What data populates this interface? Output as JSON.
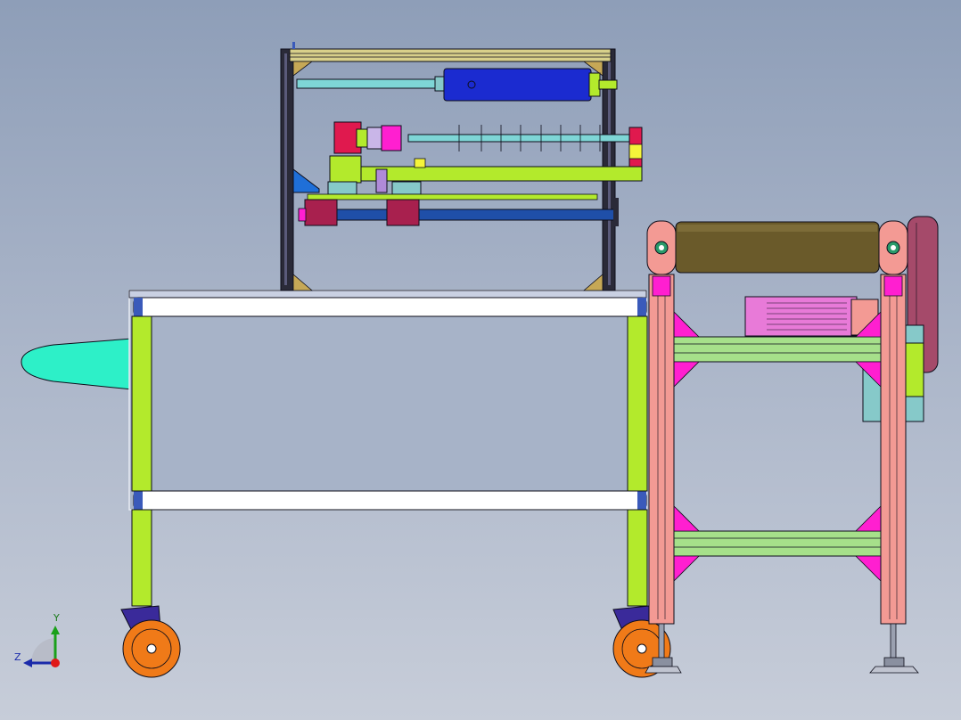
{
  "view": {
    "background_top": "#8e9eb8",
    "background_bottom": "#c7cdd9"
  },
  "colors": {
    "frame_green": "#b3ea2c",
    "frame_dark": "#2a2a38",
    "outline": "#0d0d1a",
    "roller_brown": "#6a5a2a",
    "cylinder_blue": "#1b2bd0",
    "rod_cyan": "#7ed6d6",
    "red_motor": "#e0194e",
    "magenta": "#ff1fd0",
    "salmon": "#f39a94",
    "teal_hopper": "#2df0c8",
    "wheel_orange": "#f07a18",
    "purple_bracket": "#3a2a9a",
    "pink_motor": "#e87ad8",
    "maroon_guard": "#a54a6a",
    "dark_blue_shaft": "#1f4fa8",
    "yellow": "#f5f53a",
    "light_teal": "#86c9c9"
  },
  "triad": {
    "y_label": "Y",
    "z_label": "Z"
  }
}
